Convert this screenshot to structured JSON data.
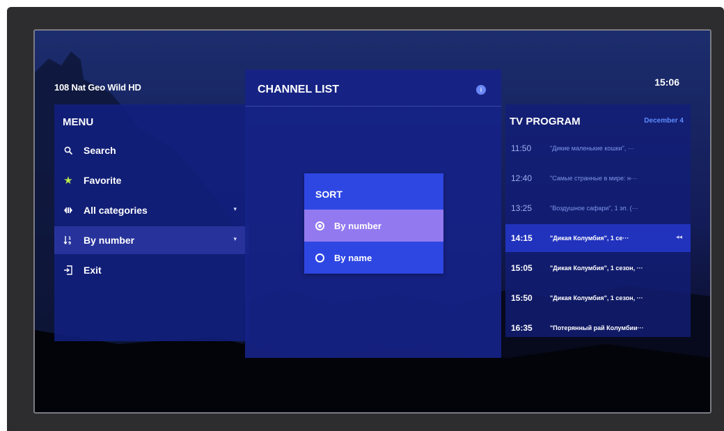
{
  "header": {
    "channel": "108  Nat Geo Wild HD",
    "clock": "15:06"
  },
  "menu": {
    "title": "MENU",
    "items": [
      {
        "label": "Search",
        "icon": "search-icon"
      },
      {
        "label": "Favorite",
        "icon": "star-icon"
      },
      {
        "label": "All categories",
        "icon": "categories-icon"
      },
      {
        "label": "By number",
        "icon": "sort-icon"
      },
      {
        "label": "Exit",
        "icon": "exit-icon"
      }
    ]
  },
  "channel_list": {
    "title": "CHANNEL LIST"
  },
  "sort_dialog": {
    "title": "SORT",
    "options": [
      {
        "label": "By number",
        "selected": true
      },
      {
        "label": "By name",
        "selected": false
      }
    ]
  },
  "tv_program": {
    "title": "TV PROGRAM",
    "date": "December 4",
    "rows": [
      {
        "time": "11:50",
        "name": "\"Дикие маленькие кошки\", ···"
      },
      {
        "time": "12:40",
        "name": "\"Самые странные в мире: н···"
      },
      {
        "time": "13:25",
        "name": "\"Воздушное сафари\", 1 эп. (···"
      },
      {
        "time": "14:15",
        "name": "\"Дикая Колумбия\", 1 се···"
      },
      {
        "time": "15:05",
        "name": "\"Дикая Колумбия\", 1 сезон, ···"
      },
      {
        "time": "15:50",
        "name": "\"Дикая Колумбия\", 1 сезон, ···"
      },
      {
        "time": "16:35",
        "name": "\"Потерянный рай Колумбии···"
      }
    ]
  },
  "colors": {
    "accent": "#2e47e3",
    "selected_option": "#9379f0",
    "date_blue": "#5e8cff"
  }
}
